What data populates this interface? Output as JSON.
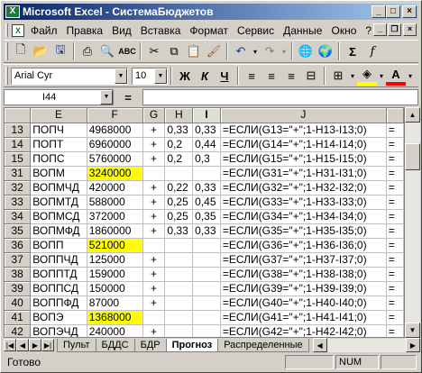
{
  "window": {
    "title": "Microsoft Excel - СистемаБюджетов",
    "app_icon": "X"
  },
  "menu": [
    "Файл",
    "Правка",
    "Вид",
    "Вставка",
    "Формат",
    "Сервис",
    "Данные",
    "Окно",
    "?"
  ],
  "formatting": {
    "font": "Arial Cyr",
    "size": "10",
    "bold": "Ж",
    "italic": "К",
    "underline": "Ч"
  },
  "formula_bar": {
    "cell_ref": "I44",
    "eq": "=",
    "value": ""
  },
  "columns": [
    "E",
    "F",
    "G",
    "H",
    "I",
    "J"
  ],
  "selected_col": "I",
  "rows": [
    {
      "n": "13",
      "e": "ПОПЧ",
      "f": "4968000",
      "g": "+",
      "h": "0,33",
      "i": "0,33",
      "j": "=ЕСЛИ(G13=\"+\";1-H13-I13;0)",
      "k": "="
    },
    {
      "n": "14",
      "e": "ПОПТ",
      "f": "6960000",
      "g": "+",
      "h": "0,2",
      "i": "0,44",
      "j": "=ЕСЛИ(G14=\"+\";1-H14-I14;0)",
      "k": "="
    },
    {
      "n": "15",
      "e": "ПОПС",
      "f": "5760000",
      "g": "+",
      "h": "0,2",
      "i": "0,3",
      "j": "=ЕСЛИ(G15=\"+\";1-H15-I15;0)",
      "k": "="
    },
    {
      "n": "31",
      "e": "ВОПМ",
      "f": "3240000",
      "hl": true,
      "g": "",
      "h": "",
      "i": "",
      "j": "=ЕСЛИ(G31=\"+\";1-H31-I31;0)",
      "k": "="
    },
    {
      "n": "32",
      "e": "ВОПМЧД",
      "f": "420000",
      "g": "+",
      "h": "0,22",
      "i": "0,33",
      "j": "=ЕСЛИ(G32=\"+\";1-H32-I32;0)",
      "k": "="
    },
    {
      "n": "33",
      "e": "ВОПМТД",
      "f": "588000",
      "g": "+",
      "h": "0,25",
      "i": "0,45",
      "j": "=ЕСЛИ(G33=\"+\";1-H33-I33;0)",
      "k": "="
    },
    {
      "n": "34",
      "e": "ВОПМСД",
      "f": "372000",
      "g": "+",
      "h": "0,25",
      "i": "0,35",
      "j": "=ЕСЛИ(G34=\"+\";1-H34-I34;0)",
      "k": "="
    },
    {
      "n": "35",
      "e": "ВОПМФД",
      "f": "1860000",
      "g": "+",
      "h": "0,33",
      "i": "0,33",
      "j": "=ЕСЛИ(G35=\"+\";1-H35-I35;0)",
      "k": "="
    },
    {
      "n": "36",
      "e": "ВОПП",
      "f": "521000",
      "hl": true,
      "g": "",
      "h": "",
      "i": "",
      "j": "=ЕСЛИ(G36=\"+\";1-H36-I36;0)",
      "k": "="
    },
    {
      "n": "37",
      "e": "ВОППЧД",
      "f": "125000",
      "g": "+",
      "h": "",
      "i": "",
      "j": "=ЕСЛИ(G37=\"+\";1-H37-I37;0)",
      "k": "="
    },
    {
      "n": "38",
      "e": "ВОППТД",
      "f": "159000",
      "g": "+",
      "h": "",
      "i": "",
      "j": "=ЕСЛИ(G38=\"+\";1-H38-I38;0)",
      "k": "="
    },
    {
      "n": "39",
      "e": "ВОППСД",
      "f": "150000",
      "g": "+",
      "h": "",
      "i": "",
      "j": "=ЕСЛИ(G39=\"+\";1-H39-I39;0)",
      "k": "="
    },
    {
      "n": "40",
      "e": "ВОППФД",
      "f": "87000",
      "g": "+",
      "h": "",
      "i": "",
      "j": "=ЕСЛИ(G40=\"+\";1-H40-I40;0)",
      "k": "="
    },
    {
      "n": "41",
      "e": "ВОПЭ",
      "f": "1368000",
      "hl": true,
      "g": "",
      "h": "",
      "i": "",
      "j": "=ЕСЛИ(G41=\"+\";1-H41-I41;0)",
      "k": "="
    },
    {
      "n": "42",
      "e": "ВОПЭЧД",
      "f": "240000",
      "g": "+",
      "h": "",
      "i": "",
      "j": "=ЕСЛИ(G42=\"+\";1-H42-I42;0)",
      "k": "="
    }
  ],
  "sheets": [
    "Пульт",
    "БДДС",
    "БДР",
    "Прогноз",
    "Распределенные"
  ],
  "active_sheet": "Прогноз",
  "status": {
    "text": "Готово",
    "num": "NUM"
  },
  "colors": {
    "highlight": "#ffff00",
    "title_start": "#0a246a"
  }
}
